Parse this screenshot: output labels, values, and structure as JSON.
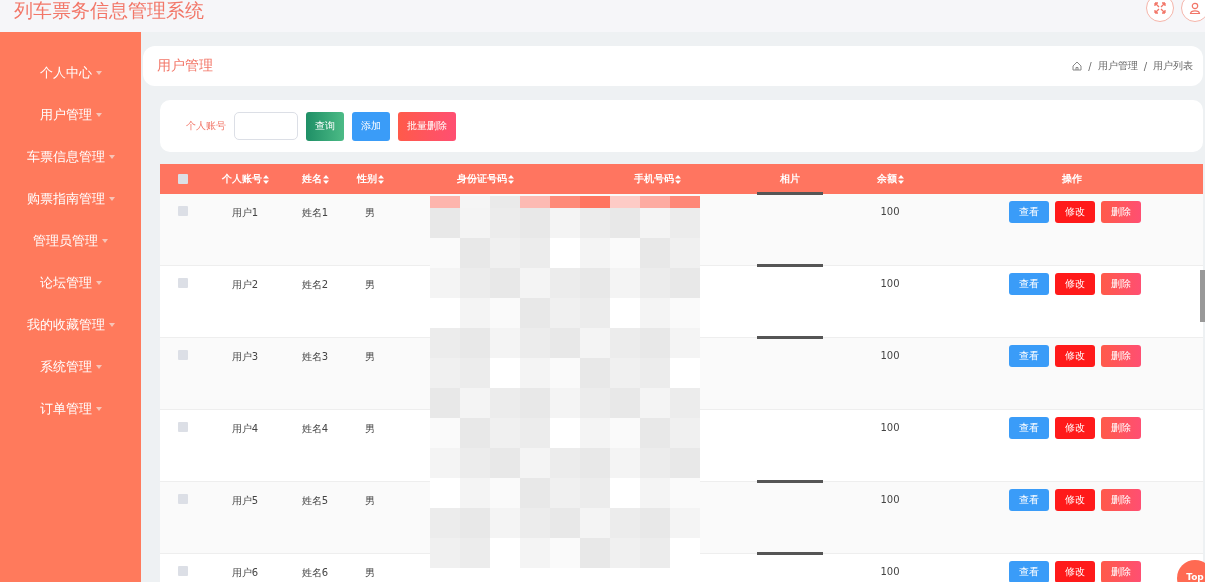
{
  "app_title": "列车票务信息管理系统",
  "sidebar": {
    "items": [
      {
        "label": "个人中心"
      },
      {
        "label": "用户管理"
      },
      {
        "label": "车票信息管理"
      },
      {
        "label": "购票指南管理"
      },
      {
        "label": "管理员管理"
      },
      {
        "label": "论坛管理"
      },
      {
        "label": "我的收藏管理"
      },
      {
        "label": "系统管理"
      },
      {
        "label": "订单管理"
      }
    ]
  },
  "page_title": "用户管理",
  "breadcrumb": [
    {
      "separator": "/",
      "label": "用户管理"
    },
    {
      "separator": "/",
      "label": "用户列表"
    }
  ],
  "search": {
    "label": "个人账号",
    "buttons": [
      {
        "kind": "query",
        "label": "查询"
      },
      {
        "kind": "add",
        "label": "添加"
      },
      {
        "kind": "batch_delete",
        "label": "批量删除"
      }
    ]
  },
  "table": {
    "select_all_checked": false,
    "columns": [
      {
        "label": "个人账号",
        "sortable": true
      },
      {
        "label": "姓名",
        "sortable": true
      },
      {
        "label": "性别",
        "sortable": true
      },
      {
        "label": "身份证号码",
        "sortable": true
      },
      {
        "label": "手机号码",
        "sortable": true
      },
      {
        "label": "相片",
        "sortable": false
      },
      {
        "label": "余额",
        "sortable": true
      },
      {
        "label": "操作",
        "sortable": false
      }
    ],
    "rows": [
      {
        "checked": false,
        "account": "用户1",
        "name": "姓名1",
        "gender": "男",
        "photo": true,
        "balance": "100",
        "actions": [
          "查看",
          "修改",
          "删除"
        ]
      },
      {
        "checked": false,
        "account": "用户2",
        "name": "姓名2",
        "gender": "男",
        "photo": true,
        "balance": "100",
        "actions": [
          "查看",
          "修改",
          "删除"
        ]
      },
      {
        "checked": false,
        "account": "用户3",
        "name": "姓名3",
        "gender": "男",
        "photo": true,
        "balance": "100",
        "actions": [
          "查看",
          "修改",
          "删除"
        ]
      },
      {
        "checked": false,
        "account": "用户4",
        "name": "姓名4",
        "gender": "男",
        "photo": false,
        "balance": "100",
        "actions": [
          "查看",
          "修改",
          "删除"
        ]
      },
      {
        "checked": false,
        "account": "用户5",
        "name": "姓名5",
        "gender": "男",
        "photo": true,
        "balance": "100",
        "actions": [
          "查看",
          "修改",
          "删除"
        ]
      },
      {
        "checked": false,
        "account": "用户6",
        "name": "姓名6",
        "gender": "男",
        "photo": true,
        "balance": "100",
        "actions": [
          "查看",
          "修改",
          "删除"
        ]
      }
    ]
  },
  "back_to_top": "Top"
}
